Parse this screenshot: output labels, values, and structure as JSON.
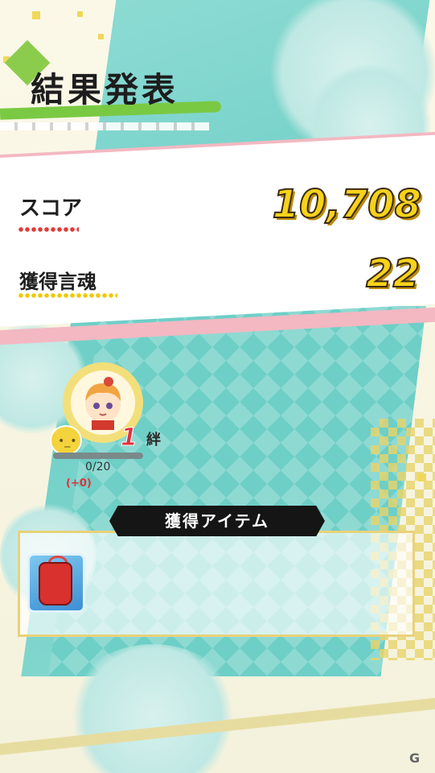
{
  "title": "結果発表",
  "score": {
    "label": "スコア",
    "value": "10,708"
  },
  "souls": {
    "label": "獲得言魂",
    "value": "22"
  },
  "bond": {
    "level": "1",
    "unit": "絆",
    "progress": "0/20",
    "gain": "(+0)",
    "fill": 0.0
  },
  "items": {
    "header": "獲得アイテム",
    "list": [
      {
        "icon": "red-omamori-charm-icon"
      }
    ]
  },
  "colors": {
    "accent_green": "#7ac943",
    "pink": "#f3b8c2",
    "teal": "#6fcfc7",
    "gold": "#f7d21b",
    "red": "#e3303a"
  }
}
